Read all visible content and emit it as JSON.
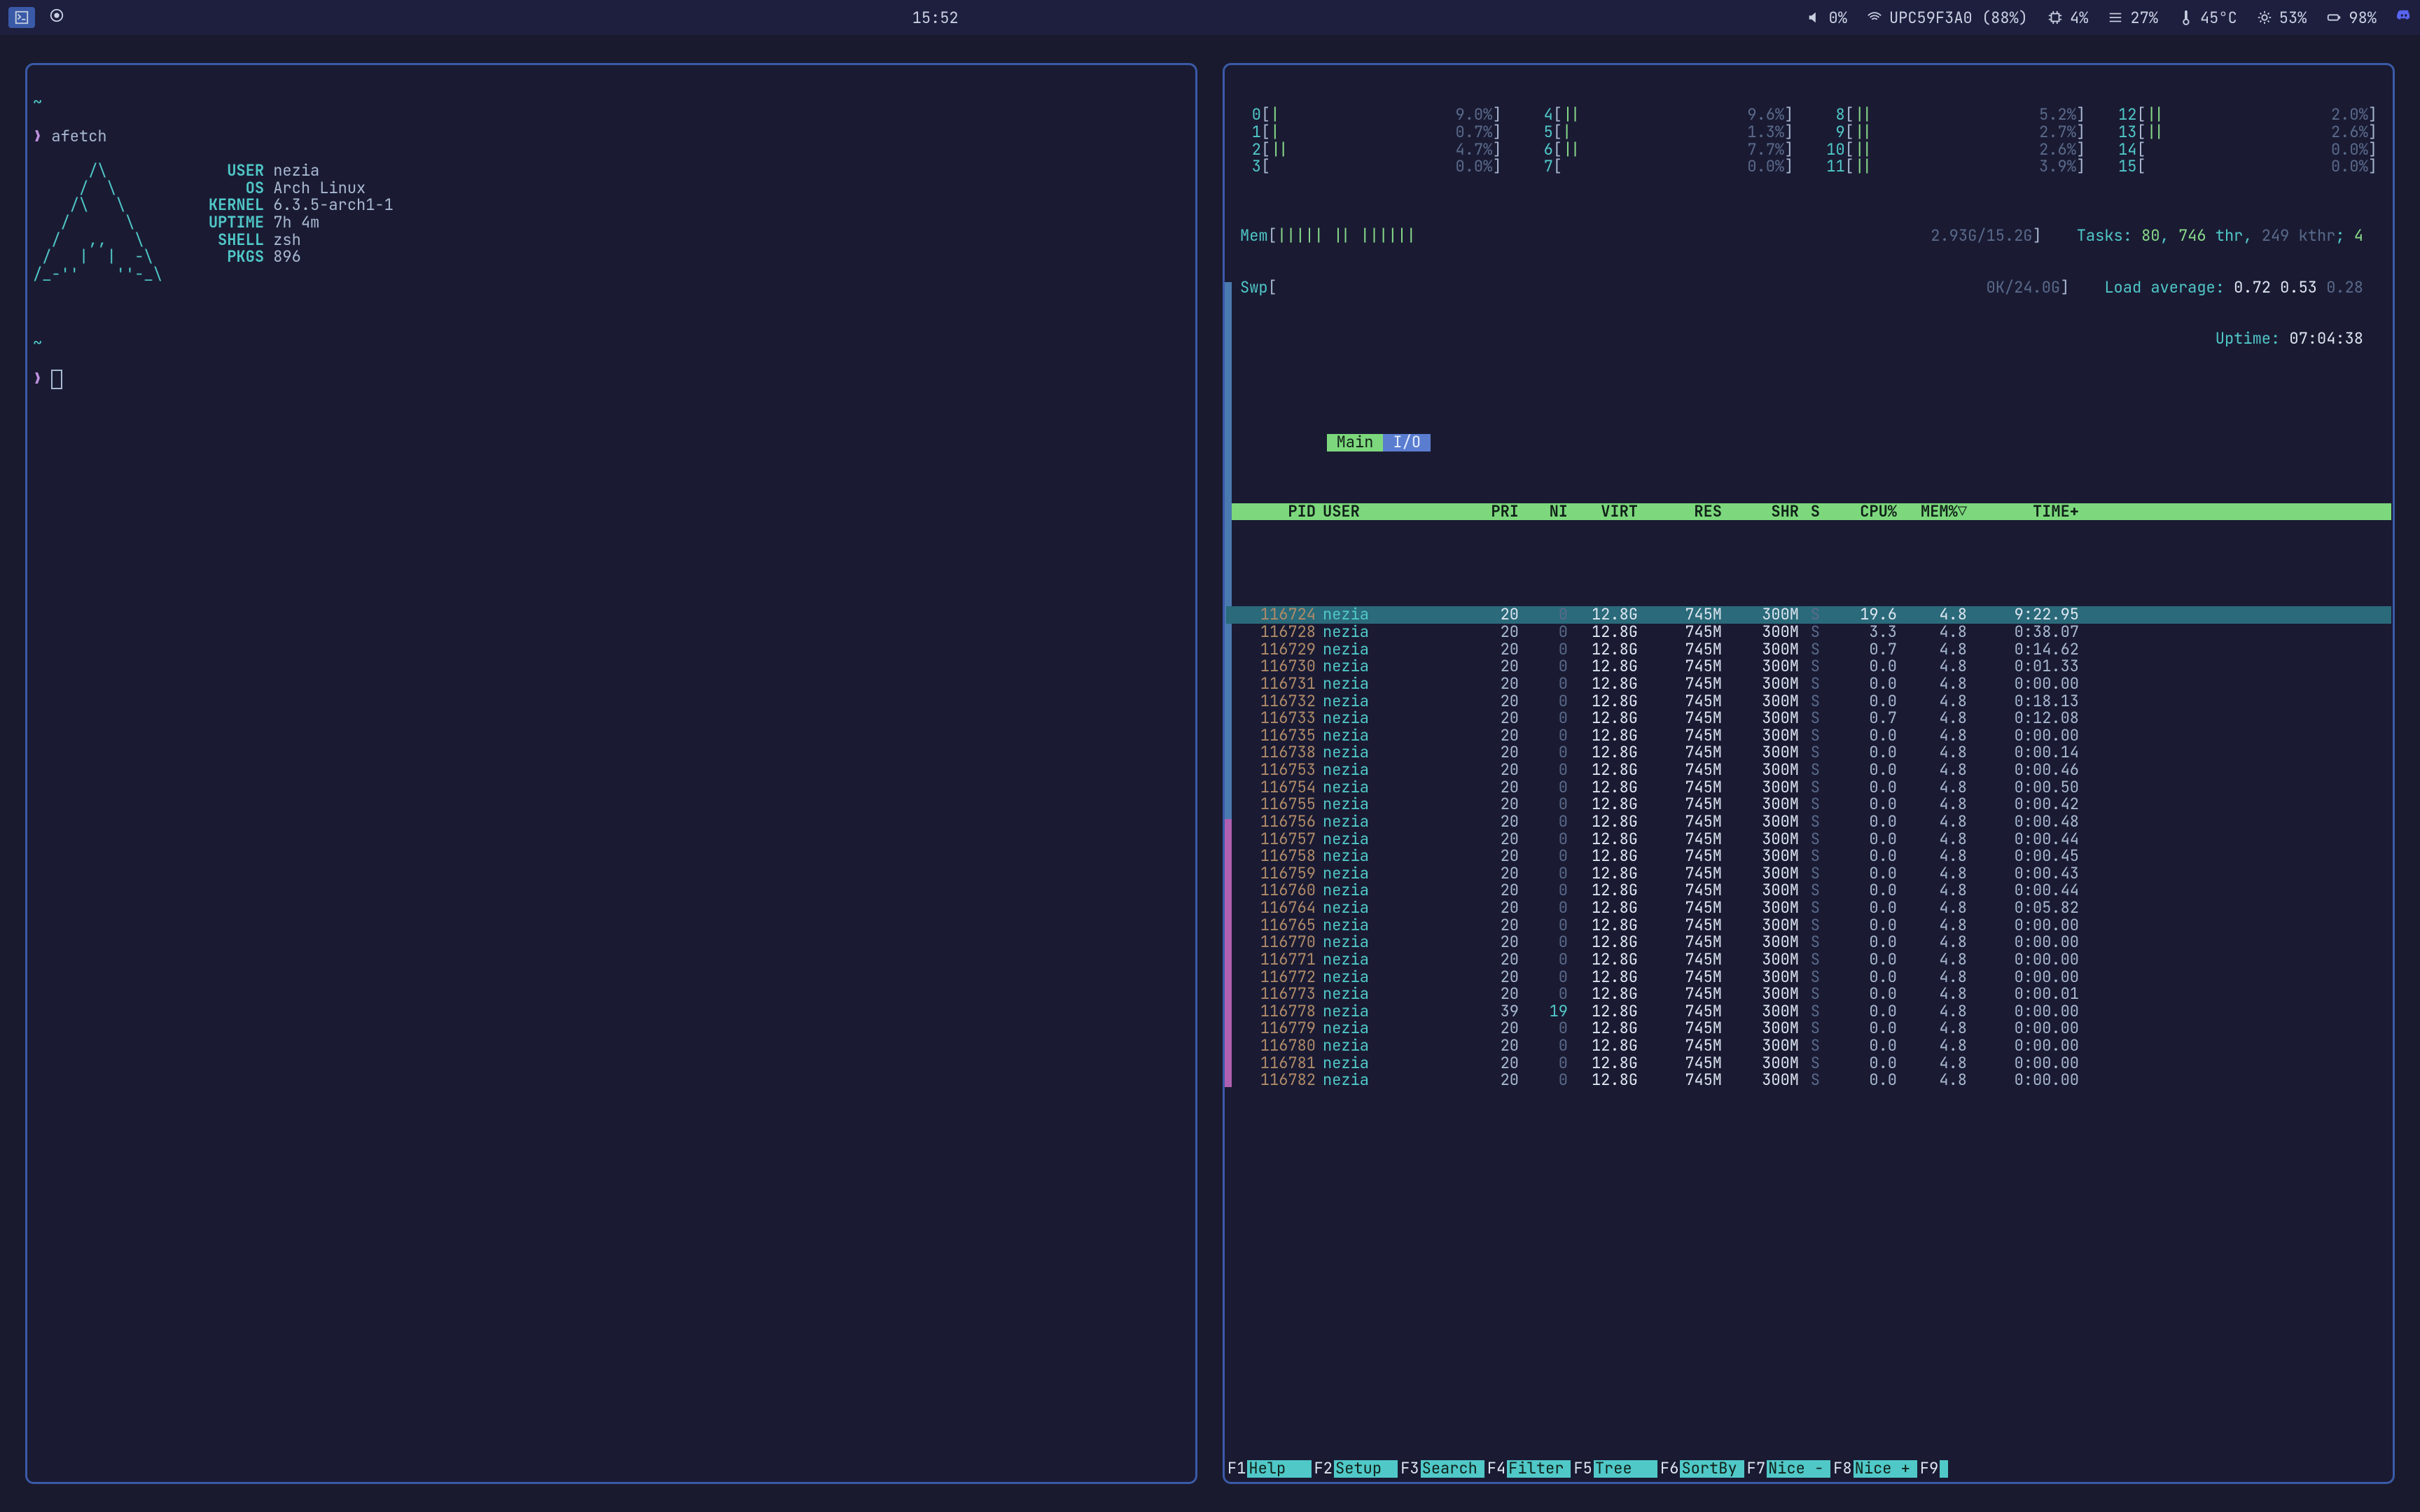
{
  "topbar": {
    "clock": "15:52",
    "volume_pct": "0%",
    "wifi_ssid": "UPC59F3A0 (88%)",
    "cpu_pct": "4%",
    "disk_pct": "27%",
    "temp": "45°C",
    "brightness_pct": "53%",
    "battery_pct": "98%"
  },
  "afetch": {
    "prompt_cmd": "afetch",
    "ascii": [
      "      /\\      ",
      "     /  \\     ",
      "    /\\   \\    ",
      "   /      \\   ",
      "  /   ,,   \\  ",
      " /   |  |  -\\ ",
      "/_-''    ''-_\\"
    ],
    "rows": [
      {
        "k": "USER",
        "v": "nezia"
      },
      {
        "k": "OS",
        "v": "Arch Linux"
      },
      {
        "k": "KERNEL",
        "v": "6.3.5-arch1-1"
      },
      {
        "k": "UPTIME",
        "v": "7h 4m"
      },
      {
        "k": "SHELL",
        "v": "zsh"
      },
      {
        "k": "PKGS",
        "v": "896"
      }
    ]
  },
  "htop": {
    "cpus": [
      {
        "id": "0",
        "bar": "|",
        "pct": "9.0%"
      },
      {
        "id": "4",
        "bar": "||",
        "pct": "9.6%"
      },
      {
        "id": "8",
        "bar": "||",
        "pct": "5.2%"
      },
      {
        "id": "12",
        "bar": "||",
        "pct": "2.0%"
      },
      {
        "id": "1",
        "bar": "|",
        "pct": "0.7%"
      },
      {
        "id": "5",
        "bar": "|",
        "pct": "1.3%"
      },
      {
        "id": "9",
        "bar": "||",
        "pct": "2.7%"
      },
      {
        "id": "13",
        "bar": "||",
        "pct": "2.6%"
      },
      {
        "id": "2",
        "bar": "||",
        "pct": "4.7%"
      },
      {
        "id": "6",
        "bar": "||",
        "pct": "7.7%"
      },
      {
        "id": "10",
        "bar": "||",
        "pct": "2.6%"
      },
      {
        "id": "14",
        "bar": "",
        "pct": "0.0%"
      },
      {
        "id": "3",
        "bar": "",
        "pct": "0.0%"
      },
      {
        "id": "7",
        "bar": "",
        "pct": "0.0%"
      },
      {
        "id": "11",
        "bar": "||",
        "pct": "3.9%"
      },
      {
        "id": "15",
        "bar": "",
        "pct": "0.0%"
      }
    ],
    "mem": {
      "label": "Mem",
      "bar": "||||| || ||||||",
      "used": "2.93G",
      "total": "15.2G"
    },
    "swp": {
      "label": "Swp",
      "bar": "",
      "used": "0K",
      "total": "24.0G"
    },
    "tasks": {
      "label": "Tasks:",
      "procs": "80",
      "thr": "746",
      "thr_lbl": "thr",
      "kthr": "249",
      "kthr_lbl": "kthr",
      "running": "4"
    },
    "load": {
      "label": "Load average:",
      "v1": "0.72",
      "v2": "0.53",
      "v3": "0.28"
    },
    "uptime": {
      "label": "Uptime:",
      "value": "07:04:38"
    },
    "tabs": {
      "main": "Main",
      "io": "I/O"
    },
    "columns": [
      "PID",
      "USER",
      "PRI",
      "NI",
      "VIRT",
      "RES",
      "SHR",
      "S",
      "CPU%",
      "MEM%▽",
      "TIME+"
    ],
    "rows": [
      {
        "pid": "116724",
        "user": "nezia",
        "pri": "20",
        "ni": "0",
        "virt": "12.8G",
        "res": "745M",
        "shr": "300M",
        "s": "S",
        "cpu": "19.6",
        "mem": "4.8",
        "time": "9:22.95",
        "sel": true
      },
      {
        "pid": "116728",
        "user": "nezia",
        "pri": "20",
        "ni": "0",
        "virt": "12.8G",
        "res": "745M",
        "shr": "300M",
        "s": "S",
        "cpu": "3.3",
        "mem": "4.8",
        "time": "0:38.07"
      },
      {
        "pid": "116729",
        "user": "nezia",
        "pri": "20",
        "ni": "0",
        "virt": "12.8G",
        "res": "745M",
        "shr": "300M",
        "s": "S",
        "cpu": "0.7",
        "mem": "4.8",
        "time": "0:14.62"
      },
      {
        "pid": "116730",
        "user": "nezia",
        "pri": "20",
        "ni": "0",
        "virt": "12.8G",
        "res": "745M",
        "shr": "300M",
        "s": "S",
        "cpu": "0.0",
        "mem": "4.8",
        "time": "0:01.33"
      },
      {
        "pid": "116731",
        "user": "nezia",
        "pri": "20",
        "ni": "0",
        "virt": "12.8G",
        "res": "745M",
        "shr": "300M",
        "s": "S",
        "cpu": "0.0",
        "mem": "4.8",
        "time": "0:00.00"
      },
      {
        "pid": "116732",
        "user": "nezia",
        "pri": "20",
        "ni": "0",
        "virt": "12.8G",
        "res": "745M",
        "shr": "300M",
        "s": "S",
        "cpu": "0.0",
        "mem": "4.8",
        "time": "0:18.13"
      },
      {
        "pid": "116733",
        "user": "nezia",
        "pri": "20",
        "ni": "0",
        "virt": "12.8G",
        "res": "745M",
        "shr": "300M",
        "s": "S",
        "cpu": "0.7",
        "mem": "4.8",
        "time": "0:12.08"
      },
      {
        "pid": "116735",
        "user": "nezia",
        "pri": "20",
        "ni": "0",
        "virt": "12.8G",
        "res": "745M",
        "shr": "300M",
        "s": "S",
        "cpu": "0.0",
        "mem": "4.8",
        "time": "0:00.00"
      },
      {
        "pid": "116738",
        "user": "nezia",
        "pri": "20",
        "ni": "0",
        "virt": "12.8G",
        "res": "745M",
        "shr": "300M",
        "s": "S",
        "cpu": "0.0",
        "mem": "4.8",
        "time": "0:00.14"
      },
      {
        "pid": "116753",
        "user": "nezia",
        "pri": "20",
        "ni": "0",
        "virt": "12.8G",
        "res": "745M",
        "shr": "300M",
        "s": "S",
        "cpu": "0.0",
        "mem": "4.8",
        "time": "0:00.46"
      },
      {
        "pid": "116754",
        "user": "nezia",
        "pri": "20",
        "ni": "0",
        "virt": "12.8G",
        "res": "745M",
        "shr": "300M",
        "s": "S",
        "cpu": "0.0",
        "mem": "4.8",
        "time": "0:00.50"
      },
      {
        "pid": "116755",
        "user": "nezia",
        "pri": "20",
        "ni": "0",
        "virt": "12.8G",
        "res": "745M",
        "shr": "300M",
        "s": "S",
        "cpu": "0.0",
        "mem": "4.8",
        "time": "0:00.42"
      },
      {
        "pid": "116756",
        "user": "nezia",
        "pri": "20",
        "ni": "0",
        "virt": "12.8G",
        "res": "745M",
        "shr": "300M",
        "s": "S",
        "cpu": "0.0",
        "mem": "4.8",
        "time": "0:00.48"
      },
      {
        "pid": "116757",
        "user": "nezia",
        "pri": "20",
        "ni": "0",
        "virt": "12.8G",
        "res": "745M",
        "shr": "300M",
        "s": "S",
        "cpu": "0.0",
        "mem": "4.8",
        "time": "0:00.44"
      },
      {
        "pid": "116758",
        "user": "nezia",
        "pri": "20",
        "ni": "0",
        "virt": "12.8G",
        "res": "745M",
        "shr": "300M",
        "s": "S",
        "cpu": "0.0",
        "mem": "4.8",
        "time": "0:00.45"
      },
      {
        "pid": "116759",
        "user": "nezia",
        "pri": "20",
        "ni": "0",
        "virt": "12.8G",
        "res": "745M",
        "shr": "300M",
        "s": "S",
        "cpu": "0.0",
        "mem": "4.8",
        "time": "0:00.43"
      },
      {
        "pid": "116760",
        "user": "nezia",
        "pri": "20",
        "ni": "0",
        "virt": "12.8G",
        "res": "745M",
        "shr": "300M",
        "s": "S",
        "cpu": "0.0",
        "mem": "4.8",
        "time": "0:00.44"
      },
      {
        "pid": "116764",
        "user": "nezia",
        "pri": "20",
        "ni": "0",
        "virt": "12.8G",
        "res": "745M",
        "shr": "300M",
        "s": "S",
        "cpu": "0.0",
        "mem": "4.8",
        "time": "0:05.82"
      },
      {
        "pid": "116765",
        "user": "nezia",
        "pri": "20",
        "ni": "0",
        "virt": "12.8G",
        "res": "745M",
        "shr": "300M",
        "s": "S",
        "cpu": "0.0",
        "mem": "4.8",
        "time": "0:00.00"
      },
      {
        "pid": "116770",
        "user": "nezia",
        "pri": "20",
        "ni": "0",
        "virt": "12.8G",
        "res": "745M",
        "shr": "300M",
        "s": "S",
        "cpu": "0.0",
        "mem": "4.8",
        "time": "0:00.00"
      },
      {
        "pid": "116771",
        "user": "nezia",
        "pri": "20",
        "ni": "0",
        "virt": "12.8G",
        "res": "745M",
        "shr": "300M",
        "s": "S",
        "cpu": "0.0",
        "mem": "4.8",
        "time": "0:00.00"
      },
      {
        "pid": "116772",
        "user": "nezia",
        "pri": "20",
        "ni": "0",
        "virt": "12.8G",
        "res": "745M",
        "shr": "300M",
        "s": "S",
        "cpu": "0.0",
        "mem": "4.8",
        "time": "0:00.00"
      },
      {
        "pid": "116773",
        "user": "nezia",
        "pri": "20",
        "ni": "0",
        "virt": "12.8G",
        "res": "745M",
        "shr": "300M",
        "s": "S",
        "cpu": "0.0",
        "mem": "4.8",
        "time": "0:00.01"
      },
      {
        "pid": "116778",
        "user": "nezia",
        "pri": "39",
        "ni": "19",
        "virt": "12.8G",
        "res": "745M",
        "shr": "300M",
        "s": "S",
        "cpu": "0.0",
        "mem": "4.8",
        "time": "0:00.00"
      },
      {
        "pid": "116779",
        "user": "nezia",
        "pri": "20",
        "ni": "0",
        "virt": "12.8G",
        "res": "745M",
        "shr": "300M",
        "s": "S",
        "cpu": "0.0",
        "mem": "4.8",
        "time": "0:00.00"
      },
      {
        "pid": "116780",
        "user": "nezia",
        "pri": "20",
        "ni": "0",
        "virt": "12.8G",
        "res": "745M",
        "shr": "300M",
        "s": "S",
        "cpu": "0.0",
        "mem": "4.8",
        "time": "0:00.00"
      },
      {
        "pid": "116781",
        "user": "nezia",
        "pri": "20",
        "ni": "0",
        "virt": "12.8G",
        "res": "745M",
        "shr": "300M",
        "s": "S",
        "cpu": "0.0",
        "mem": "4.8",
        "time": "0:00.00"
      },
      {
        "pid": "116782",
        "user": "nezia",
        "pri": "20",
        "ni": "0",
        "virt": "12.8G",
        "res": "745M",
        "shr": "300M",
        "s": "S",
        "cpu": "0.0",
        "mem": "4.8",
        "time": "0:00.00"
      }
    ],
    "fn": [
      {
        "k": "F1",
        "l": "Help  "
      },
      {
        "k": "F2",
        "l": "Setup "
      },
      {
        "k": "F3",
        "l": "Search"
      },
      {
        "k": "F4",
        "l": "Filter"
      },
      {
        "k": "F5",
        "l": "Tree  "
      },
      {
        "k": "F6",
        "l": "SortBy"
      },
      {
        "k": "F7",
        "l": "Nice -"
      },
      {
        "k": "F8",
        "l": "Nice +"
      },
      {
        "k": "F9",
        "l": ""
      }
    ]
  }
}
